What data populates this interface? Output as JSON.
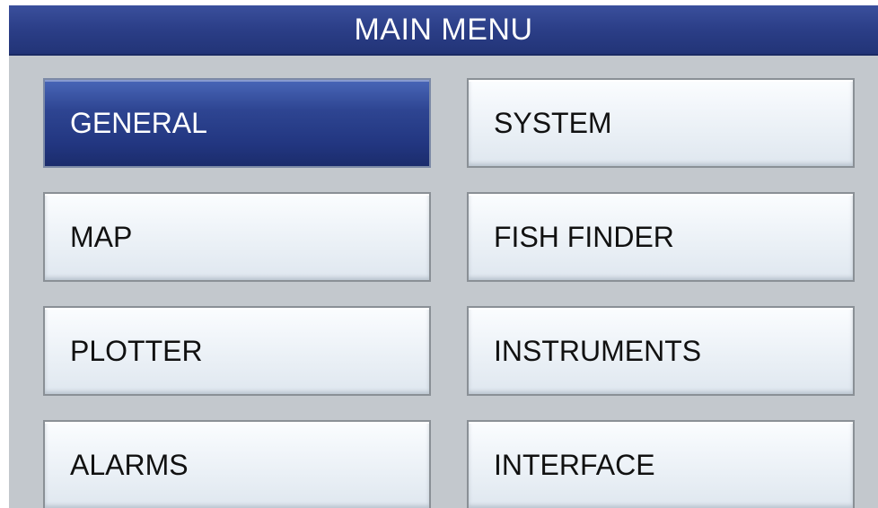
{
  "title": "MAIN MENU",
  "colors": {
    "title_bar": "#2b3e87",
    "selected_button": "#2a3f8c",
    "button_face": "#eef3f8",
    "background": "#c3c8cd"
  },
  "menu": {
    "items": [
      {
        "label": "GENERAL",
        "selected": true
      },
      {
        "label": "SYSTEM",
        "selected": false
      },
      {
        "label": "MAP",
        "selected": false
      },
      {
        "label": "FISH FINDER",
        "selected": false
      },
      {
        "label": "PLOTTER",
        "selected": false
      },
      {
        "label": "INSTRUMENTS",
        "selected": false
      },
      {
        "label": "ALARMS",
        "selected": false
      },
      {
        "label": "INTERFACE",
        "selected": false
      }
    ]
  }
}
